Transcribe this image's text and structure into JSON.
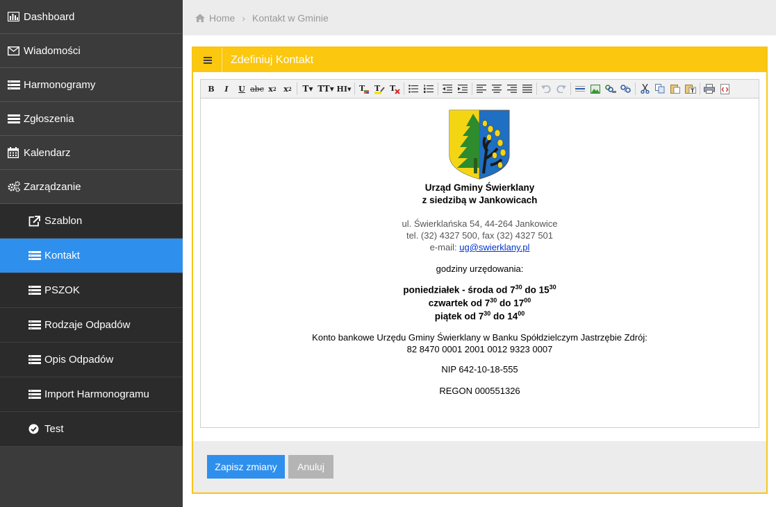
{
  "sidebar": {
    "items": [
      {
        "label": "Dashboard",
        "icon": "bar-chart-icon"
      },
      {
        "label": "Wiadomości",
        "icon": "envelope-icon"
      },
      {
        "label": "Harmonogramy",
        "icon": "list-icon"
      },
      {
        "label": "Zgłoszenia",
        "icon": "list-icon"
      },
      {
        "label": "Kalendarz",
        "icon": "calendar-icon"
      },
      {
        "label": "Zarządzanie",
        "icon": "cogs-icon"
      }
    ],
    "subitems": [
      {
        "label": "Szablon",
        "icon": "external-link-icon"
      },
      {
        "label": "Kontakt",
        "icon": "list-icon",
        "active": true
      },
      {
        "label": "PSZOK",
        "icon": "list-icon"
      },
      {
        "label": "Rodzaje Odpadów",
        "icon": "list-icon"
      },
      {
        "label": "Opis Odpadów",
        "icon": "list-icon"
      },
      {
        "label": "Import Harmonogramu",
        "icon": "list-icon"
      },
      {
        "label": "Test",
        "icon": "check-circle-icon"
      }
    ]
  },
  "breadcrumb": {
    "home": "Home",
    "current": "Kontakt w Gminie"
  },
  "panel": {
    "title": "Zdefiniuj Kontakt"
  },
  "editor": {
    "office_line1": "Urząd Gminy Świerklany",
    "office_line2": "z siedzibą w Jankowicach",
    "address": "ul. Świerklańska 54, 44-264 Jankowice",
    "phone": "tel. (32) 4327 500, fax (32) 4327 501",
    "email_label": "e-mail:",
    "email": "ug@swierklany.pl",
    "hours_heading": "godziny urzędowania:",
    "hours": {
      "mon_wed_prefix": "poniedziałek - środa od 7",
      "mon_wed_from_min": "30",
      "mon_wed_mid": " do 15",
      "mon_wed_to_min": "30",
      "thu_prefix": "czwartek od 7",
      "thu_from_min": "30",
      "thu_mid": " do 17",
      "thu_to_min": "00",
      "fri_prefix": "piątek od 7",
      "fri_from_min": "30",
      "fri_mid": " do 14",
      "fri_to_min": "00"
    },
    "bank_line": "Konto bankowe Urzędu Gminy Świerklany w Banku Spółdzielczym Jastrzębie Zdrój:",
    "account": "82 8470 0001 2001 0012 9323 0007",
    "nip": "NIP 642-10-18-555",
    "regon": "REGON 000551326"
  },
  "buttons": {
    "save": "Zapisz zmiany",
    "cancel": "Anuluj"
  },
  "colors": {
    "accent": "#2f8fed",
    "panel_border": "#f7c51c",
    "sidebar": "#3b3b3b"
  }
}
